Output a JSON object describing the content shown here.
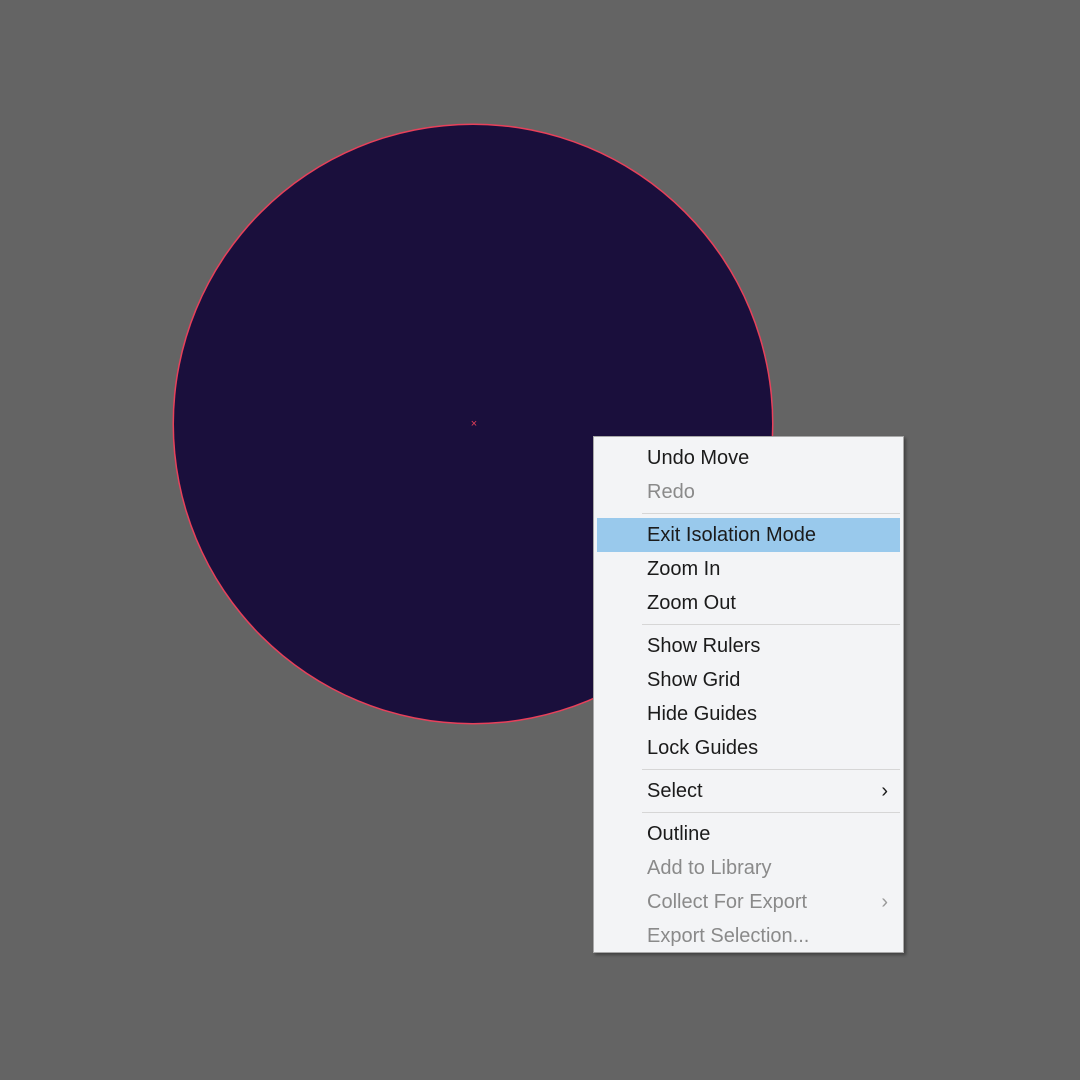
{
  "colors": {
    "canvas_background": "#646464",
    "circle_fill": "#1a0f3c",
    "selection_stroke": "#e8405a",
    "menu_background": "#f3f4f6",
    "menu_highlight": "#99c9ec",
    "disabled_text": "#8a8a8a"
  },
  "icons": {
    "center_point": "×",
    "submenu_arrow": "›"
  },
  "context_menu": {
    "groups": [
      [
        {
          "label": "Undo Move",
          "enabled": true
        },
        {
          "label": "Redo",
          "enabled": false
        }
      ],
      [
        {
          "label": "Exit Isolation Mode",
          "enabled": true,
          "highlighted": true
        },
        {
          "label": "Zoom In",
          "enabled": true
        },
        {
          "label": "Zoom Out",
          "enabled": true
        }
      ],
      [
        {
          "label": "Show Rulers",
          "enabled": true
        },
        {
          "label": "Show Grid",
          "enabled": true
        },
        {
          "label": "Hide Guides",
          "enabled": true
        },
        {
          "label": "Lock Guides",
          "enabled": true
        }
      ],
      [
        {
          "label": "Select",
          "enabled": true,
          "submenu": true
        }
      ],
      [
        {
          "label": "Outline",
          "enabled": true
        },
        {
          "label": "Add to Library",
          "enabled": false
        },
        {
          "label": "Collect For Export",
          "enabled": false,
          "submenu": true
        },
        {
          "label": "Export Selection...",
          "enabled": false
        }
      ]
    ]
  }
}
